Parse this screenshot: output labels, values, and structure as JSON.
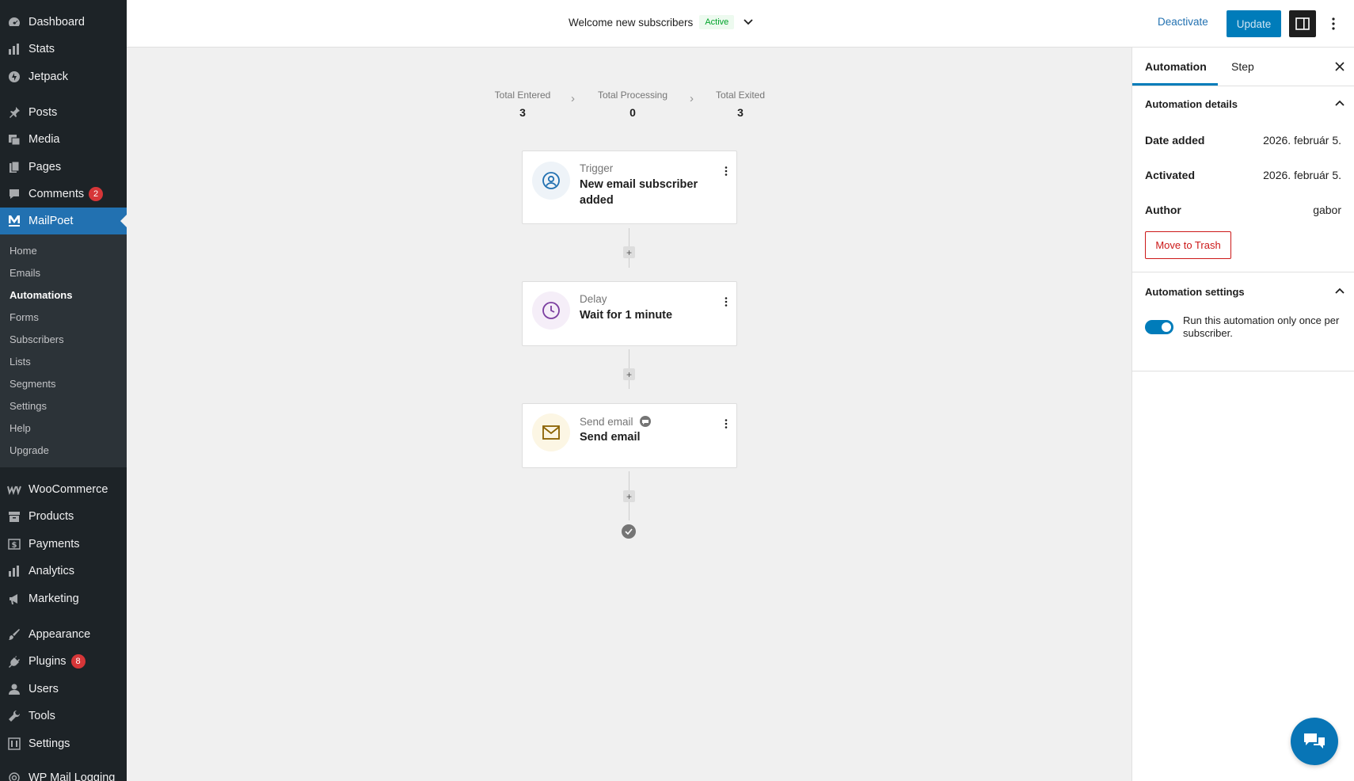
{
  "sidebar": {
    "items": [
      {
        "label": "Dashboard",
        "icon": "dashboard-icon"
      },
      {
        "label": "Stats",
        "icon": "stats-icon"
      },
      {
        "label": "Jetpack",
        "icon": "jetpack-icon"
      },
      {
        "label": "Posts",
        "icon": "pin-icon"
      },
      {
        "label": "Media",
        "icon": "media-icon"
      },
      {
        "label": "Pages",
        "icon": "pages-icon"
      },
      {
        "label": "Comments",
        "icon": "comment-icon",
        "badge": "2"
      },
      {
        "label": "MailPoet",
        "icon": "mailpoet-icon"
      },
      {
        "label": "WooCommerce",
        "icon": "woo-icon"
      },
      {
        "label": "Products",
        "icon": "archive-icon"
      },
      {
        "label": "Payments",
        "icon": "dollar-icon"
      },
      {
        "label": "Analytics",
        "icon": "bar-chart-icon"
      },
      {
        "label": "Marketing",
        "icon": "megaphone-icon"
      },
      {
        "label": "Appearance",
        "icon": "brush-icon"
      },
      {
        "label": "Plugins",
        "icon": "plug-icon",
        "badge": "8"
      },
      {
        "label": "Users",
        "icon": "user-icon"
      },
      {
        "label": "Tools",
        "icon": "wrench-icon"
      },
      {
        "label": "Settings",
        "icon": "settings-icon"
      },
      {
        "label": "WP Mail Logging",
        "icon": "at-icon"
      }
    ],
    "submenu": [
      "Home",
      "Emails",
      "Automations",
      "Forms",
      "Subscribers",
      "Lists",
      "Segments",
      "Settings",
      "Help",
      "Upgrade"
    ]
  },
  "header": {
    "automation_name": "Welcome new subscribers",
    "status": "Active",
    "deactivate": "Deactivate",
    "update": "Update"
  },
  "stats": {
    "entered_label": "Total Entered",
    "entered": "3",
    "processing_label": "Total Processing",
    "processing": "0",
    "exited_label": "Total Exited",
    "exited": "3"
  },
  "steps": [
    {
      "type": "Trigger",
      "title": "New email subscriber added",
      "icon": "user-circle-icon"
    },
    {
      "type": "Delay",
      "title": "Wait for 1 minute",
      "icon": "clock-icon"
    },
    {
      "type": "Send email",
      "title": "Send email",
      "icon": "envelope-icon"
    }
  ],
  "panel": {
    "tab_automation": "Automation",
    "tab_step": "Step",
    "details_heading": "Automation details",
    "date_added_label": "Date added",
    "date_added": "2026. február 5.",
    "activated_label": "Activated",
    "activated": "2026. február 5.",
    "author_label": "Author",
    "author": "gabor",
    "trash": "Move to Trash",
    "settings_heading": "Automation settings",
    "run_once_label": "Run this automation only once per subscriber.",
    "run_once_enabled": true
  },
  "colors": {
    "accent": "#007cba",
    "sidebar_bg": "#1d2327",
    "current_menu": "#2271b1",
    "danger": "#cc1818",
    "active_status": "#00a32a"
  }
}
